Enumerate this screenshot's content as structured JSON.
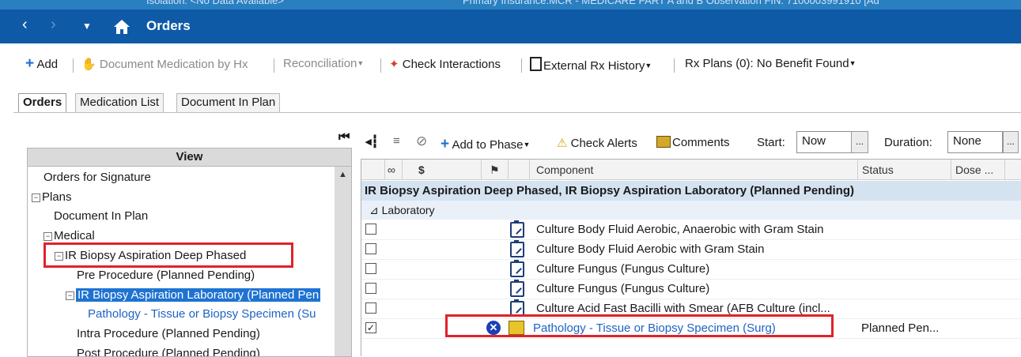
{
  "top_strip": {
    "left_text": "Isolation: <No Data Available>",
    "right_text": "Primary Insurance:MCR - MEDICARE PART A and B Observation FIN: 7100003991910 [Ad"
  },
  "titlebar": {
    "title": "Orders"
  },
  "toolbar": {
    "add": "Add",
    "document_medication": "Document Medication by Hx",
    "reconciliation": "Reconciliation",
    "check_interactions": "Check Interactions",
    "external_rx_history": "External Rx History",
    "rx_plans": "Rx Plans (0): No Benefit Found"
  },
  "tabs": [
    "Orders",
    "Medication List",
    "Document In Plan"
  ],
  "view_panel": {
    "header": "View",
    "items": [
      "Orders for Signature",
      "Plans",
      "Document In Plan",
      "Medical",
      "IR Biopsy Aspiration Deep Phased",
      "Pre Procedure (Planned Pending)",
      "IR Biopsy Aspiration Laboratory (Planned Pen",
      "Pathology - Tissue or Biopsy Specimen (Su",
      "Intra Procedure (Planned Pending)",
      "Post Procedure (Planned Pending)"
    ]
  },
  "right_toolbar": {
    "add_to_phase": "Add to Phase",
    "check_alerts": "Check Alerts",
    "comments": "Comments",
    "start_label": "Start:",
    "start_value": "Now",
    "duration_label": "Duration:",
    "duration_value": "None",
    "ellipsis": "..."
  },
  "grid": {
    "columns": [
      "$",
      "Component",
      "Status",
      "Dose ..."
    ],
    "group_title": "IR Biopsy Aspiration Deep Phased, IR Biopsy Aspiration Laboratory (Planned Pending)",
    "subgroup": "Laboratory",
    "rows": [
      {
        "component": "Culture Body Fluid Aerobic, Anaerobic with Gram Stain",
        "status": "",
        "checked": false
      },
      {
        "component": "Culture Body Fluid Aerobic with Gram Stain",
        "status": "",
        "checked": false
      },
      {
        "component": "Culture Fungus (Fungus Culture)",
        "status": "",
        "checked": false
      },
      {
        "component": "Culture Fungus (Fungus Culture)",
        "status": "",
        "checked": false
      },
      {
        "component": "Culture Acid Fast Bacilli with Smear (AFB Culture (incl...",
        "status": "",
        "checked": false
      },
      {
        "component": "Pathology - Tissue or Biopsy Specimen (Surg)",
        "status": "Planned Pen...",
        "checked": true
      }
    ]
  },
  "colors": {
    "titlebar": "#0e5aa7",
    "selection": "#1e73d2",
    "highlight_box": "#e0222a",
    "link": "#1e63c4"
  }
}
